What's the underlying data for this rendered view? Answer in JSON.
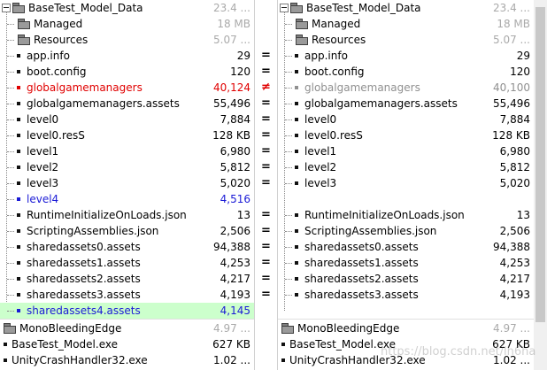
{
  "left": {
    "root": {
      "name": "BaseTest_Model_Data",
      "size": "23.4 ..."
    },
    "rows": [
      {
        "name": "Managed",
        "size": "18 MB",
        "kind": "folder",
        "sizeDim": true
      },
      {
        "name": "Resources",
        "size": "5.07 ...",
        "kind": "folder",
        "sizeDim": true
      },
      {
        "name": "app.info",
        "size": "29"
      },
      {
        "name": "boot.config",
        "size": "120"
      },
      {
        "name": "globalgamemanagers",
        "size": "40,124",
        "style": "red"
      },
      {
        "name": "globalgamemanagers.assets",
        "size": "55,496"
      },
      {
        "name": "level0",
        "size": "7,884"
      },
      {
        "name": "level0.resS",
        "size": "128 KB"
      },
      {
        "name": "level1",
        "size": "6,980"
      },
      {
        "name": "level2",
        "size": "5,812"
      },
      {
        "name": "level3",
        "size": "5,020"
      },
      {
        "name": "level4",
        "size": "4,516",
        "style": "blue"
      },
      {
        "name": "RuntimeInitializeOnLoads.json",
        "size": "13"
      },
      {
        "name": "ScriptingAssemblies.json",
        "size": "2,506"
      },
      {
        "name": "sharedassets0.assets",
        "size": "94,388"
      },
      {
        "name": "sharedassets1.assets",
        "size": "4,253"
      },
      {
        "name": "sharedassets2.assets",
        "size": "4,217"
      },
      {
        "name": "sharedassets3.assets",
        "size": "4,193"
      },
      {
        "name": "sharedassets4.assets",
        "size": "4,145",
        "style": "blue",
        "highlight": true
      }
    ],
    "bottom": [
      {
        "name": "MonoBleedingEdge",
        "size": "4.97 ...",
        "kind": "folder",
        "sizeDim": true
      },
      {
        "name": "BaseTest_Model.exe",
        "size": "627 KB"
      },
      {
        "name": "UnityCrashHandler32.exe",
        "size": "1.02 ..."
      }
    ]
  },
  "right": {
    "root": {
      "name": "BaseTest_Model_Data",
      "size": "23.4 ..."
    },
    "rows": [
      {
        "name": "Managed",
        "size": "18 MB",
        "kind": "folder",
        "sizeDim": true
      },
      {
        "name": "Resources",
        "size": "5.07 ...",
        "kind": "folder",
        "sizeDim": true
      },
      {
        "name": "app.info",
        "size": "29"
      },
      {
        "name": "boot.config",
        "size": "120"
      },
      {
        "name": "globalgamemanagers",
        "size": "40,100",
        "style": "grey"
      },
      {
        "name": "globalgamemanagers.assets",
        "size": "55,496"
      },
      {
        "name": "level0",
        "size": "7,884"
      },
      {
        "name": "level0.resS",
        "size": "128 KB"
      },
      {
        "name": "level1",
        "size": "6,980"
      },
      {
        "name": "level2",
        "size": "5,812"
      },
      {
        "name": "level3",
        "size": "5,020"
      },
      null,
      {
        "name": "RuntimeInitializeOnLoads.json",
        "size": "13"
      },
      {
        "name": "ScriptingAssemblies.json",
        "size": "2,506"
      },
      {
        "name": "sharedassets0.assets",
        "size": "94,388"
      },
      {
        "name": "sharedassets1.assets",
        "size": "4,253"
      },
      {
        "name": "sharedassets2.assets",
        "size": "4,217"
      },
      {
        "name": "sharedassets3.assets",
        "size": "4,193"
      },
      null
    ],
    "bottom": [
      {
        "name": "MonoBleedingEdge",
        "size": "4.97 ...",
        "kind": "folder",
        "sizeDim": true
      },
      {
        "name": "BaseTest_Model.exe",
        "size": "627 KB"
      },
      {
        "name": "UnityCrashHandler32.exe",
        "size": "1.02 ..."
      }
    ]
  },
  "compare": [
    "",
    "",
    "",
    "",
    "=",
    "=",
    "≠",
    "=",
    "=",
    "=",
    "=",
    "=",
    "=",
    "",
    "=",
    "=",
    "=",
    "=",
    "=",
    "=",
    "",
    "",
    "",
    "",
    ""
  ],
  "colors": {
    "diff_red": "#e00000",
    "orphan_blue": "#1a1ad6",
    "highlight_green": "#ccffcc"
  },
  "watermark": "https://blog.csdn.net/lh6ha"
}
